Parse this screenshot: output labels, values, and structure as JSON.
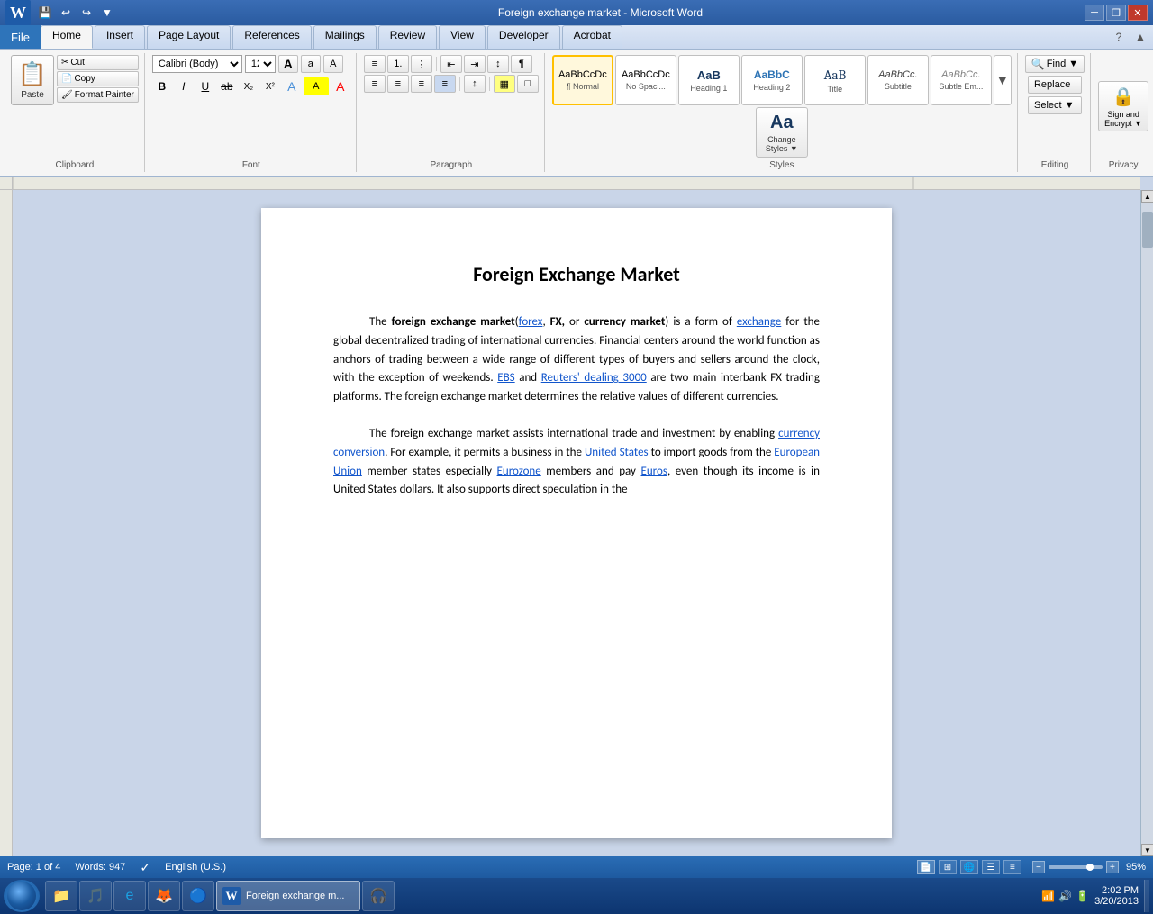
{
  "titlebar": {
    "title": "Foreign exchange market - Microsoft Word",
    "minimize": "─",
    "restore": "❐",
    "close": "✕"
  },
  "quickaccess": {
    "save": "💾",
    "undo": "↩",
    "redo": "↪",
    "dropdown": "▼"
  },
  "tabs": {
    "items": [
      "File",
      "Home",
      "Insert",
      "Page Layout",
      "References",
      "Mailings",
      "Review",
      "View",
      "Developer",
      "Acrobat"
    ],
    "active": "Home"
  },
  "ribbon": {
    "clipboard": {
      "label": "Clipboard",
      "paste_label": "Paste",
      "cut_label": "Cut",
      "copy_label": "Copy",
      "format_painter_label": "Format Painter"
    },
    "font": {
      "label": "Font",
      "family": "Calibri (Body)",
      "size": "12",
      "grow_label": "A",
      "shrink_label": "a",
      "clear_label": "A",
      "bold_label": "B",
      "italic_label": "I",
      "underline_label": "U",
      "strikethrough_label": "ab",
      "subscript_label": "X₂",
      "superscript_label": "X²",
      "highlight_label": "A",
      "color_label": "A"
    },
    "paragraph": {
      "label": "Paragraph",
      "bullets_label": "≡",
      "numbering_label": "1.",
      "multi_level_label": "⋮",
      "decrease_indent_label": "←",
      "increase_indent_label": "→",
      "sort_label": "↕",
      "show_marks_label": "¶",
      "align_left_label": "≡",
      "center_label": "≡",
      "right_label": "≡",
      "justify_label": "≡",
      "line_spacing_label": "↕",
      "shading_label": "▦",
      "border_label": "□"
    },
    "styles": {
      "label": "Styles",
      "items": [
        {
          "name": "Normal",
          "preview": "AaBbCcDc",
          "sublabel": "¶ Normal",
          "active": true
        },
        {
          "name": "No Spacing",
          "preview": "AaBbCcDc",
          "sublabel": "No Spaci...",
          "active": false
        },
        {
          "name": "Heading 1",
          "preview": "AaB",
          "sublabel": "Heading 1",
          "active": false
        },
        {
          "name": "Heading 2",
          "preview": "AaBbC",
          "sublabel": "Heading 2",
          "active": false
        },
        {
          "name": "Title",
          "preview": "AaB",
          "sublabel": "Title",
          "active": false
        },
        {
          "name": "Subtitle",
          "preview": "AaBbC.",
          "sublabel": "Subtitle",
          "active": false
        },
        {
          "name": "Subtle Em",
          "preview": "AaBbCc.",
          "sublabel": "Subtle Em...",
          "active": false
        },
        {
          "name": "Change Styles",
          "preview": "Aa",
          "sublabel": "Change\nStyles ▼",
          "active": false
        }
      ]
    },
    "editing": {
      "label": "Editing",
      "find_label": "Find ▼",
      "replace_label": "Replace",
      "select_label": "Select ▼"
    },
    "privacy": {
      "label": "Privacy",
      "sign_encrypt_label": "Sign and\nEncrypt ▼"
    }
  },
  "document": {
    "title": "Foreign Exchange Market",
    "paragraphs": [
      {
        "id": "para1",
        "text_before": "The ",
        "bold_text": "foreign exchange market",
        "paren_open": "(",
        "link1": "forex",
        "comma1": ",",
        "bold2": " FX,",
        "paren_middle": " or ",
        "bold3": "currency market",
        "paren_close": ")",
        "text_after": " is a form of ",
        "link2": "exchange",
        "text_end": " for the global decentralized trading of international currencies. Financial centers around the world function as anchors of trading between a wide range of different types of buyers and sellers around the clock, with the exception of weekends. ",
        "link3": "EBS",
        "text_and": " and ",
        "link4": "Reuters' dealing 3000",
        "text_final": " are two main interbank FX trading platforms. The foreign exchange market determines the relative values of different currencies."
      },
      {
        "id": "para2",
        "text_before": "The foreign exchange market assists international trade and investment by enabling ",
        "link1": "currency conversion",
        "text_mid": ". For example, it permits a business in the ",
        "link2": "United States",
        "text_mid2": " to import goods from the ",
        "link3": "European Union",
        "text_mid3": " member states especially ",
        "link4": "Eurozone",
        "text_mid4": " members and pay ",
        "link5": "Euros",
        "text_end": ", even though its income is in United States dollars. It also supports direct speculation in the"
      }
    ]
  },
  "statusbar": {
    "page_info": "Page: 1 of 4",
    "words_label": "Words: 947",
    "language": "English (U.S.)",
    "zoom": "95%"
  },
  "taskbar": {
    "time": "2:02 PM",
    "date": "3/20/2013",
    "programs": [
      "🖥",
      "📁",
      "🎵",
      "🌐",
      "🦊",
      "🔵"
    ],
    "word_label": "W"
  }
}
